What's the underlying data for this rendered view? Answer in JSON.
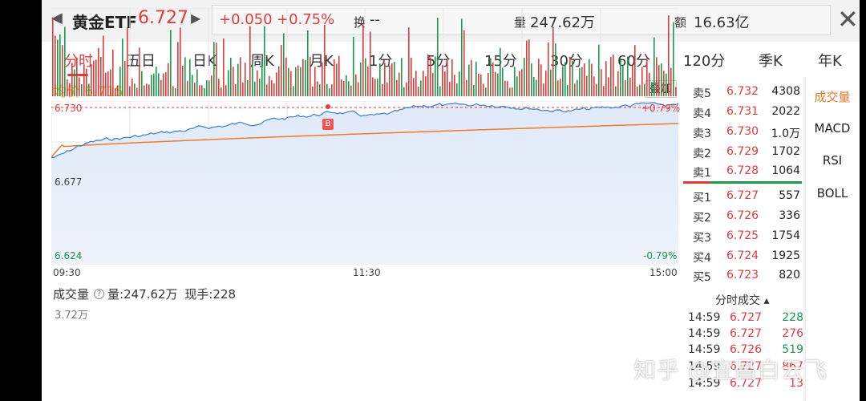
{
  "header": {
    "name": "黄金ETF",
    "price": "6.727",
    "change": "+0.050",
    "change_pct": "+0.75%",
    "turnover_label": "换",
    "turnover_value": "--",
    "volume_label": "量",
    "volume_value": "247.62万",
    "amount_label": "额",
    "amount_value": "16.63亿"
  },
  "tabs": [
    "分时",
    "五日",
    "日K",
    "周K",
    "月K",
    "1分",
    "5分",
    "15分",
    "30分",
    "60分",
    "120分",
    "季K",
    "年K"
  ],
  "chart": {
    "avg_label": "均价 6.715",
    "overlay_button": "叠加",
    "y_high": "6.730",
    "y_mid": "6.677",
    "y_low": "6.624",
    "pct_high": "+0.79%",
    "pct_low": "-0.79%",
    "x_start": "09:30",
    "x_mid": "11:30",
    "x_end": "15:00",
    "marker": "B"
  },
  "volume": {
    "title": "成交量",
    "total": "量:247.62万",
    "current": "现手:228",
    "max": "3.72万"
  },
  "order_book": {
    "asks": [
      {
        "label": "卖5",
        "price": "6.732",
        "qty": "4308"
      },
      {
        "label": "卖4",
        "price": "6.731",
        "qty": "2022"
      },
      {
        "label": "卖3",
        "price": "6.730",
        "qty": "1.0万"
      },
      {
        "label": "卖2",
        "price": "6.729",
        "qty": "1702"
      },
      {
        "label": "卖1",
        "price": "6.728",
        "qty": "1064"
      }
    ],
    "bids": [
      {
        "label": "买1",
        "price": "6.727",
        "qty": "557"
      },
      {
        "label": "买2",
        "price": "6.726",
        "qty": "336"
      },
      {
        "label": "买3",
        "price": "6.725",
        "qty": "1754"
      },
      {
        "label": "买4",
        "price": "6.724",
        "qty": "1925"
      },
      {
        "label": "买5",
        "price": "6.723",
        "qty": "820"
      }
    ]
  },
  "ticks": {
    "title": "分时成交",
    "rows": [
      {
        "time": "14:59",
        "price": "6.727",
        "vol": "228"
      },
      {
        "time": "14:59",
        "price": "6.727",
        "vol": "276"
      },
      {
        "time": "14:59",
        "price": "6.726",
        "vol": "519"
      },
      {
        "time": "14:59",
        "price": "6.727",
        "vol": "867"
      },
      {
        "time": "14:59",
        "price": "6.727",
        "vol": "13"
      }
    ]
  },
  "indicators": [
    "成交量",
    "MACD",
    "RSI",
    "BOLL"
  ],
  "watermark": "知乎 @宜昌白云飞",
  "colors": {
    "up": "#e03c3c",
    "down": "#1a9a4a",
    "price_line": "#3a7bd5",
    "avg_line": "#f07a2a"
  }
}
